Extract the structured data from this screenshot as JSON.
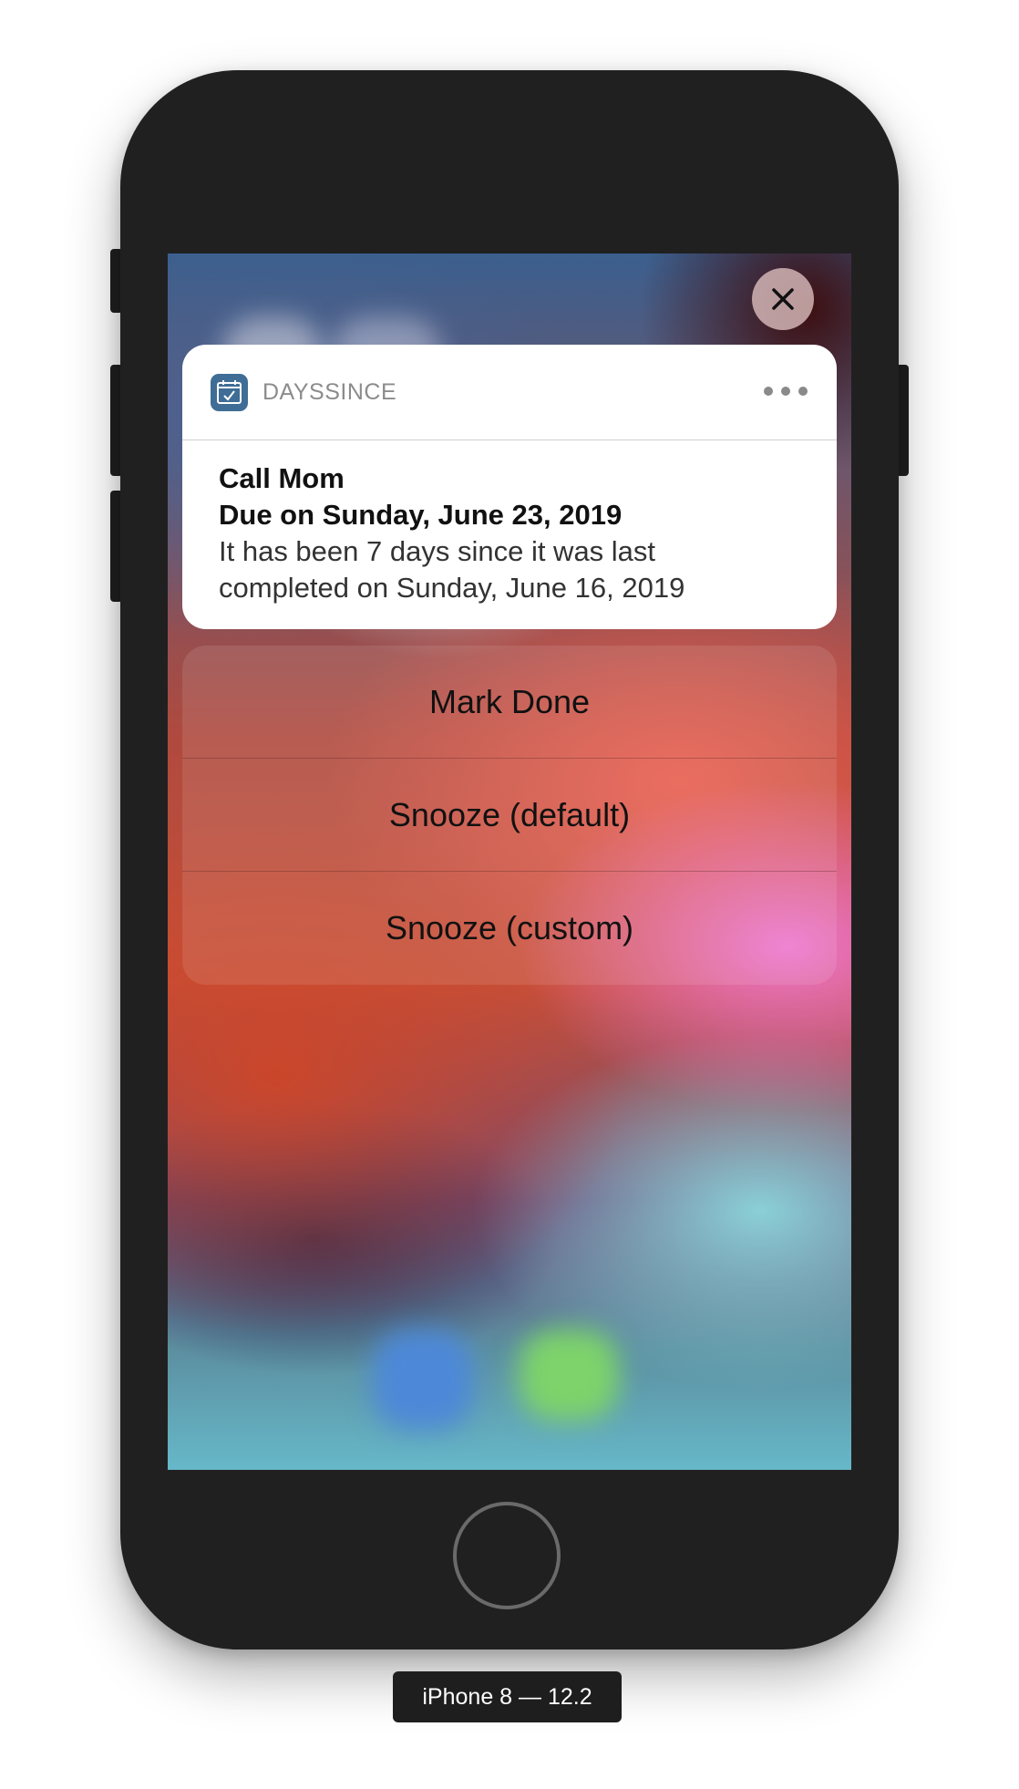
{
  "notification": {
    "app_name": "DAYSSINCE",
    "app_icon": "calendar-check-icon",
    "title": "Call Mom",
    "subtitle": "Due on Sunday, June 23, 2019",
    "body_line1": "It has been 7 days since it was last",
    "body_line2": "completed on Sunday, June 16, 2019"
  },
  "actions": {
    "mark_done": "Mark Done",
    "snooze_default": "Snooze (default)",
    "snooze_custom": "Snooze (custom)"
  },
  "device": {
    "label": "iPhone 8 — 12.2"
  },
  "icons": {
    "close": "close-icon",
    "more": "more-icon"
  },
  "colors": {
    "app_icon_bg": "#3f6d95",
    "phone_body": "#202020",
    "label_bg": "#1e1e1e"
  }
}
